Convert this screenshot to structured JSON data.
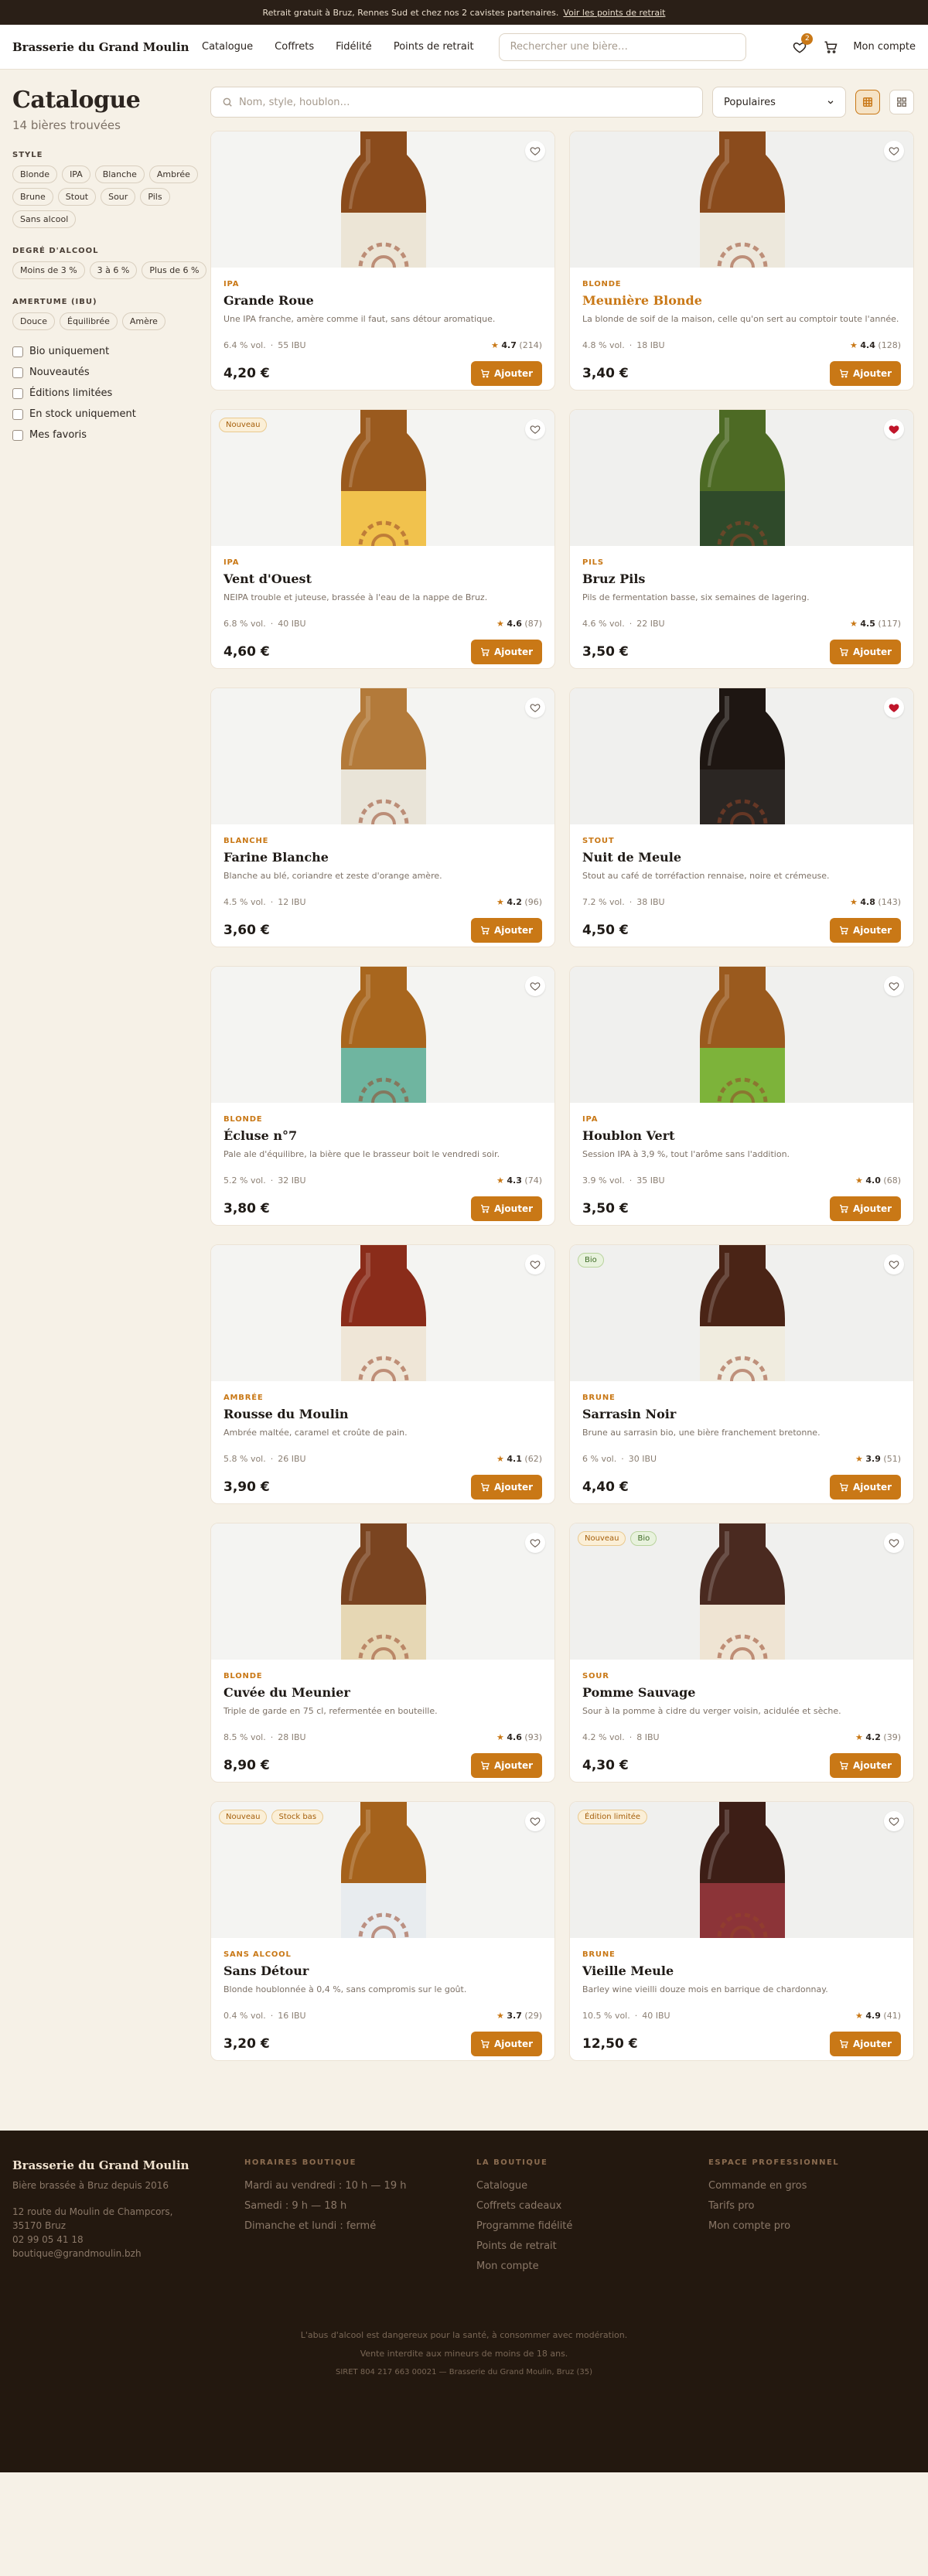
{
  "topbar": {
    "text": "Retrait gratuit à Bruz, Rennes Sud et chez nos 2 cavistes partenaires.",
    "link": "Voir les points de retrait"
  },
  "header": {
    "logo": "Brasserie du Grand Moulin",
    "nav": [
      "Catalogue",
      "Coffrets",
      "Fidélité",
      "Points de retrait"
    ],
    "search_placeholder": "Rechercher une bière…",
    "cart_count": "2",
    "account": "Mon compte"
  },
  "sidebar": {
    "title": "Catalogue",
    "count": "14 bières trouvées",
    "style_title": "STYLE",
    "styles": [
      "Blonde",
      "IPA",
      "Blanche",
      "Ambrée",
      "Brune",
      "Stout",
      "Sour",
      "Pils",
      "Sans alcool"
    ],
    "alcohol_title": "DEGRÉ D'ALCOOL",
    "alcohol": [
      "Moins de 3 %",
      "3 à 6 %",
      "Plus de 6 %"
    ],
    "ibu_title": "AMERTUME (IBU)",
    "ibu": [
      "Douce",
      "Équilibrée",
      "Amère"
    ],
    "checks": [
      "Bio uniquement",
      "Nouveautés",
      "Éditions limitées",
      "En stock uniquement",
      "Mes favoris"
    ]
  },
  "toolbar": {
    "search_placeholder": "Nom, style, houblon…",
    "sort": "Populaires"
  },
  "colors": {
    "accent": "#c97816",
    "favorite": "#c0152a"
  },
  "products": [
    {
      "style": "IPA",
      "name": "Grande Roue",
      "desc": "Une IPA franche, amère comme il faut, sans détour aromatique.",
      "abv": "6.4 % vol.",
      "ibu": "55 IBU",
      "rating": "4.7",
      "reviews": "(214)",
      "price": "4,20 €",
      "add": "Ajouter",
      "tags": [],
      "fav": false,
      "accent": false,
      "glass": "#8a4b1c",
      "label": "#ece5d6",
      "bg": "#f4f4f2"
    },
    {
      "style": "BLONDE",
      "name": "Meunière Blonde",
      "desc": "La blonde de soif de la maison, celle qu'on sert au comptoir toute l'année.",
      "abv": "4.8 % vol.",
      "ibu": "18 IBU",
      "rating": "4.4",
      "reviews": "(128)",
      "price": "3,40 €",
      "add": "Ajouter",
      "tags": [],
      "fav": false,
      "accent": true,
      "glass": "#8a4b1c",
      "label": "#ede8dc",
      "bg": "#f0f0ee"
    },
    {
      "style": "IPA",
      "name": "Vent d'Ouest",
      "desc": "NEIPA trouble et juteuse, brassée à l'eau de la nappe de Bruz.",
      "abv": "6.8 % vol.",
      "ibu": "40 IBU",
      "rating": "4.6",
      "reviews": "(87)",
      "price": "4,60 €",
      "add": "Ajouter",
      "tags": [
        "Nouveau"
      ],
      "fav": false,
      "accent": false,
      "glass": "#9a5a1e",
      "label": "#f1c24d",
      "bg": "#f4f4f2"
    },
    {
      "style": "PILS",
      "name": "Bruz Pils",
      "desc": "Pils de fermentation basse, six semaines de lagering.",
      "abv": "4.6 % vol.",
      "ibu": "22 IBU",
      "rating": "4.5",
      "reviews": "(117)",
      "price": "3,50 €",
      "add": "Ajouter",
      "tags": [],
      "fav": true,
      "accent": false,
      "glass": "#4d6a24",
      "label": "#2f4a2a",
      "bg": "#f0f0ee"
    },
    {
      "style": "BLANCHE",
      "name": "Farine Blanche",
      "desc": "Blanche au blé, coriandre et zeste d'orange amère.",
      "abv": "4.5 % vol.",
      "ibu": "12 IBU",
      "rating": "4.2",
      "reviews": "(96)",
      "price": "3,60 €",
      "add": "Ajouter",
      "tags": [],
      "fav": false,
      "accent": false,
      "glass": "#b37a3a",
      "label": "#e9e4d8",
      "bg": "#f4f4f2"
    },
    {
      "style": "STOUT",
      "name": "Nuit de Meule",
      "desc": "Stout au café de torréfaction rennaise, noire et crémeuse.",
      "abv": "7.2 % vol.",
      "ibu": "38 IBU",
      "rating": "4.8",
      "reviews": "(143)",
      "price": "4,50 €",
      "add": "Ajouter",
      "tags": [],
      "fav": true,
      "accent": false,
      "glass": "#1e1612",
      "label": "#2b2623",
      "bg": "#f0f0ee"
    },
    {
      "style": "BLONDE",
      "name": "Écluse n°7",
      "desc": "Pale ale d'équilibre, la bière que le brasseur boit le vendredi soir.",
      "abv": "5.2 % vol.",
      "ibu": "32 IBU",
      "rating": "4.3",
      "reviews": "(74)",
      "price": "3,80 €",
      "add": "Ajouter",
      "tags": [],
      "fav": false,
      "accent": false,
      "glass": "#a8661e",
      "label": "#6fb5a0",
      "bg": "#f4f4f2"
    },
    {
      "style": "IPA",
      "name": "Houblon Vert",
      "desc": "Session IPA à 3,9 %, tout l'arôme sans l'addition.",
      "abv": "3.9 % vol.",
      "ibu": "35 IBU",
      "rating": "4.0",
      "reviews": "(68)",
      "price": "3,50 €",
      "add": "Ajouter",
      "tags": [],
      "fav": false,
      "accent": false,
      "glass": "#9a5a1e",
      "label": "#7db33a",
      "bg": "#f0f0ee"
    },
    {
      "style": "AMBRÉE",
      "name": "Rousse du Moulin",
      "desc": "Ambrée maltée, caramel et croûte de pain.",
      "abv": "5.8 % vol.",
      "ibu": "26 IBU",
      "rating": "4.1",
      "reviews": "(62)",
      "price": "3,90 €",
      "add": "Ajouter",
      "tags": [],
      "fav": false,
      "accent": false,
      "glass": "#8a2c1a",
      "label": "#efe6d7",
      "bg": "#f4f4f2"
    },
    {
      "style": "BRUNE",
      "name": "Sarrasin Noir",
      "desc": "Brune au sarrasin bio, une bière franchement bretonne.",
      "abv": "6 % vol.",
      "ibu": "30 IBU",
      "rating": "3.9",
      "reviews": "(51)",
      "price": "4,40 €",
      "add": "Ajouter",
      "tags": [
        "Bio"
      ],
      "fav": false,
      "accent": false,
      "glass": "#4a2416",
      "label": "#f0ecdf",
      "bg": "#f0f0ee"
    },
    {
      "style": "BLONDE",
      "name": "Cuvée du Meunier",
      "desc": "Triple de garde en 75 cl, refermentée en bouteille.",
      "abv": "8.5 % vol.",
      "ibu": "28 IBU",
      "rating": "4.6",
      "reviews": "(93)",
      "price": "8,90 €",
      "add": "Ajouter",
      "tags": [],
      "fav": false,
      "accent": false,
      "glass": "#7a4420",
      "label": "#e6d7b4",
      "bg": "#f4f4f2"
    },
    {
      "style": "SOUR",
      "name": "Pomme Sauvage",
      "desc": "Sour à la pomme à cidre du verger voisin, acidulée et sèche.",
      "abv": "4.2 % vol.",
      "ibu": "8 IBU",
      "rating": "4.2",
      "reviews": "(39)",
      "price": "4,30 €",
      "add": "Ajouter",
      "tags": [
        "Nouveau",
        "Bio"
      ],
      "fav": false,
      "accent": false,
      "glass": "#4a2a20",
      "label": "#efe4d3",
      "bg": "#f0f0ee"
    },
    {
      "style": "SANS ALCOOL",
      "name": "Sans Détour",
      "desc": "Blonde houblonnée à 0,4 %, sans compromis sur le goût.",
      "abv": "0.4 % vol.",
      "ibu": "16 IBU",
      "rating": "3.7",
      "reviews": "(29)",
      "price": "3,20 €",
      "add": "Ajouter",
      "tags": [
        "Nouveau",
        "Stock bas"
      ],
      "fav": false,
      "accent": false,
      "glass": "#a5621c",
      "label": "#e8ecef",
      "bg": "#f4f4f2"
    },
    {
      "style": "BRUNE",
      "name": "Vieille Meule",
      "desc": "Barley wine vieilli douze mois en barrique de chardonnay.",
      "abv": "10.5 % vol.",
      "ibu": "40 IBU",
      "rating": "4.9",
      "reviews": "(41)",
      "price": "12,50 €",
      "add": "Ajouter",
      "tags": [
        "Édition limitée"
      ],
      "fav": false,
      "accent": false,
      "glass": "#3d1e16",
      "label": "#8c3438",
      "bg": "#f0f0ee"
    }
  ],
  "footer": {
    "brand": "Brasserie du Grand Moulin",
    "tagline": "Bière brassée à Bruz depuis 2016",
    "address": [
      "12 route du Moulin de Champcors,",
      "35170 Bruz"
    ],
    "phone": "02 99 05 41 18",
    "email": "boutique@grandmoulin.bzh",
    "hours_title": "HORAIRES BOUTIQUE",
    "hours": [
      "Mardi au vendredi : 10 h — 19 h",
      "Samedi : 9 h — 18 h",
      "Dimanche et lundi : fermé"
    ],
    "shop_title": "LA BOUTIQUE",
    "shop": [
      "Catalogue",
      "Coffrets cadeaux",
      "Programme fidélité",
      "Points de retrait",
      "Mon compte"
    ],
    "pro_title": "ESPACE PROFESSIONNEL",
    "pro": [
      "Commande en gros",
      "Tarifs pro",
      "Mon compte pro"
    ],
    "legal": [
      "L'abus d'alcool est dangereux pour la santé, à consommer avec modération.",
      "Vente interdite aux mineurs de moins de 18 ans.",
      "SIRET 804 217 663 00021 — Brasserie du Grand Moulin, Bruz (35)"
    ]
  }
}
